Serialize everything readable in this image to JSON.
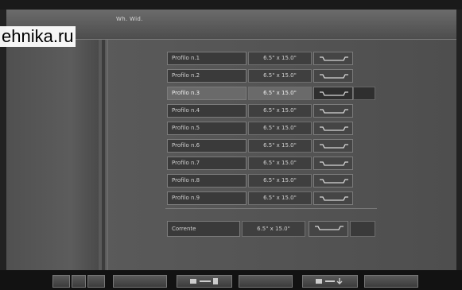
{
  "header": {
    "title": "Wh. Wid."
  },
  "watermark": {
    "text": "ehnika.ru"
  },
  "rows": [
    {
      "name": "Profilo n.1",
      "size": "6.5\" x 15.0\""
    },
    {
      "name": "Profilo n.2",
      "size": "6.5\" x 15.0\""
    },
    {
      "name": "Profilo n.3",
      "size": "6.5\" x 15.0\"",
      "selected": true
    },
    {
      "name": "Profilo n.4",
      "size": "6.5\" x 15.0\""
    },
    {
      "name": "Profilo n.5",
      "size": "6.5\" x 15.0\""
    },
    {
      "name": "Profilo n.6",
      "size": "6.5\" x 15.0\""
    },
    {
      "name": "Profilo n.7",
      "size": "6.5\" x 15.0\""
    },
    {
      "name": "Profilo n.8",
      "size": "6.5\" x 15.0\""
    },
    {
      "name": "Profilo n.9",
      "size": "6.5\" x 15.0\""
    }
  ],
  "current": {
    "name": "Corrente",
    "size": "6.5\" x 15.0\""
  },
  "footer": {
    "buttons": [
      "",
      "",
      "",
      "",
      "",
      "",
      "",
      "",
      ""
    ],
    "right_text_line1": "",
    "right_text_line2": ""
  },
  "icons": {
    "rim-profile-icon": "rim-profile-icon",
    "save-icon": "save-icon",
    "load-icon": "load-icon"
  },
  "colors": {
    "background": "#4e4e4e",
    "selected_row": "#6a6a6a",
    "cell_border": "#7c7c7c"
  }
}
